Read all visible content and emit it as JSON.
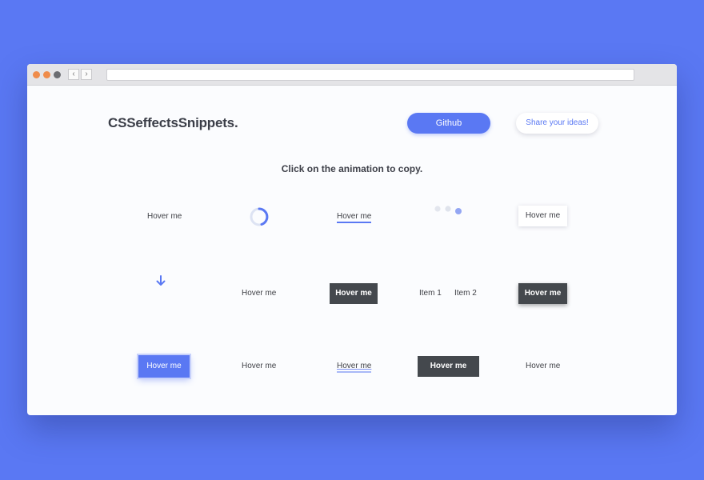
{
  "page": {
    "background": "#5a78f3"
  },
  "header": {
    "logo_text": "CSSeffectsSnippets.",
    "github_label": "Github",
    "share_label": "Share your ideas!"
  },
  "instruction": "Click on the animation to copy.",
  "snippets": {
    "r1c1": "Hover me",
    "r1c3": "Hover me",
    "r1c5": "Hover me",
    "r2c2": "Hover me",
    "r2c3": "Hover me",
    "r2c4_item1": "Item 1",
    "r2c4_item2": "Item 2",
    "r2c5": "Hover me",
    "r3c1": "Hover me",
    "r3c2": "Hover me",
    "r3c3": "Hover me",
    "r3c4": "Hover me",
    "r3c5": "Hover me"
  },
  "icons": {
    "spinner": "spinner-icon",
    "dots": "loading-dots-icon",
    "arrow": "arrow-down-icon"
  },
  "colors": {
    "accent": "#5a78f3",
    "dark_button": "#44484d",
    "text": "#3d3f48"
  }
}
